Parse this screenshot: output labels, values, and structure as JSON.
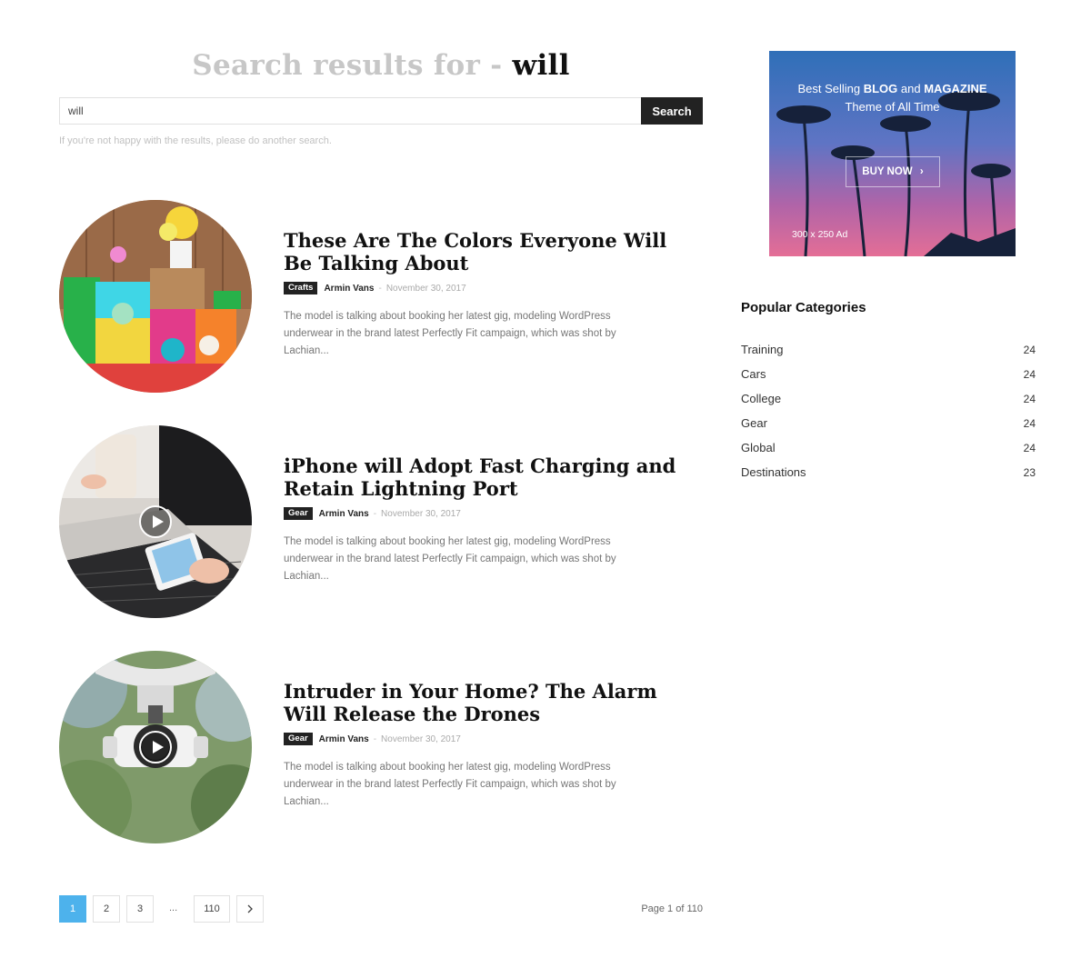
{
  "search": {
    "title_prefix": "Search results for - ",
    "title_term": "will",
    "input_value": "will",
    "button_label": "Search",
    "hint": "If you're not happy with the results, please do another search."
  },
  "posts": [
    {
      "title": "These Are The Colors Everyone Will Be Talking About",
      "category": "Crafts",
      "author": "Armin Vans",
      "date": "November 30, 2017",
      "excerpt": "The model is talking about booking her latest gig, modeling WordPress underwear in the brand latest Perfectly Fit campaign, which was shot by Lachian...",
      "has_video": false
    },
    {
      "title": "iPhone will Adopt Fast Charging and Retain Lightning Port",
      "category": "Gear",
      "author": "Armin Vans",
      "date": "November 30, 2017",
      "excerpt": "The model is talking about booking her latest gig, modeling WordPress underwear in the brand latest Perfectly Fit campaign, which was shot by Lachian...",
      "has_video": true
    },
    {
      "title": "Intruder in Your Home? The Alarm Will Release the Drones",
      "category": "Gear",
      "author": "Armin Vans",
      "date": "November 30, 2017",
      "excerpt": "The model is talking about booking her latest gig, modeling WordPress underwear in the brand latest Perfectly Fit campaign, which was shot by Lachian...",
      "has_video": true
    }
  ],
  "pagination": {
    "pages": [
      "1",
      "2",
      "3"
    ],
    "dots": "...",
    "last": "110",
    "next_icon": "chevron-right-icon",
    "info": "Page 1 of 110",
    "active_color": "#4db2ec"
  },
  "ad": {
    "line1_pre": "Best Selling ",
    "line1_bold": "BLOG",
    "line1_mid": " and ",
    "line1_bold2": "MAGAZINE",
    "line2": "Theme of All Time",
    "button": "BUY NOW",
    "size_label": "300 x 250 Ad"
  },
  "sidebar": {
    "heading": "Popular Categories",
    "categories": [
      {
        "name": "Training",
        "count": "24"
      },
      {
        "name": "Cars",
        "count": "24"
      },
      {
        "name": "College",
        "count": "24"
      },
      {
        "name": "Gear",
        "count": "24"
      },
      {
        "name": "Global",
        "count": "24"
      },
      {
        "name": "Destinations",
        "count": "23"
      }
    ]
  }
}
